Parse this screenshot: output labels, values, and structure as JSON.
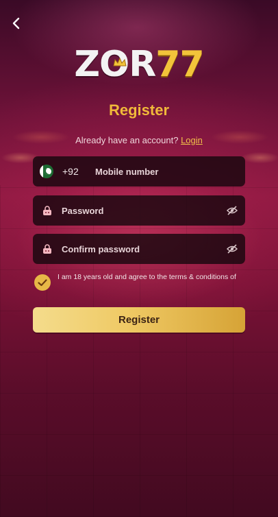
{
  "brand": {
    "logo_text": "ZOR",
    "logo_number": "77",
    "accent_color": "#f0b93a"
  },
  "page": {
    "title": "Register"
  },
  "login_prompt": {
    "text": "Already have an account?",
    "link": "Login"
  },
  "phone_field": {
    "country_code": "+92",
    "placeholder": "Mobile number",
    "flag_icon": "pakistan-flag-icon"
  },
  "password_field": {
    "placeholder": "Password"
  },
  "confirm_password_field": {
    "placeholder": "Confirm password"
  },
  "agreement": {
    "text": "I am 18 years old and agree to the terms & conditions of",
    "checked": true
  },
  "submit": {
    "label": "Register"
  }
}
